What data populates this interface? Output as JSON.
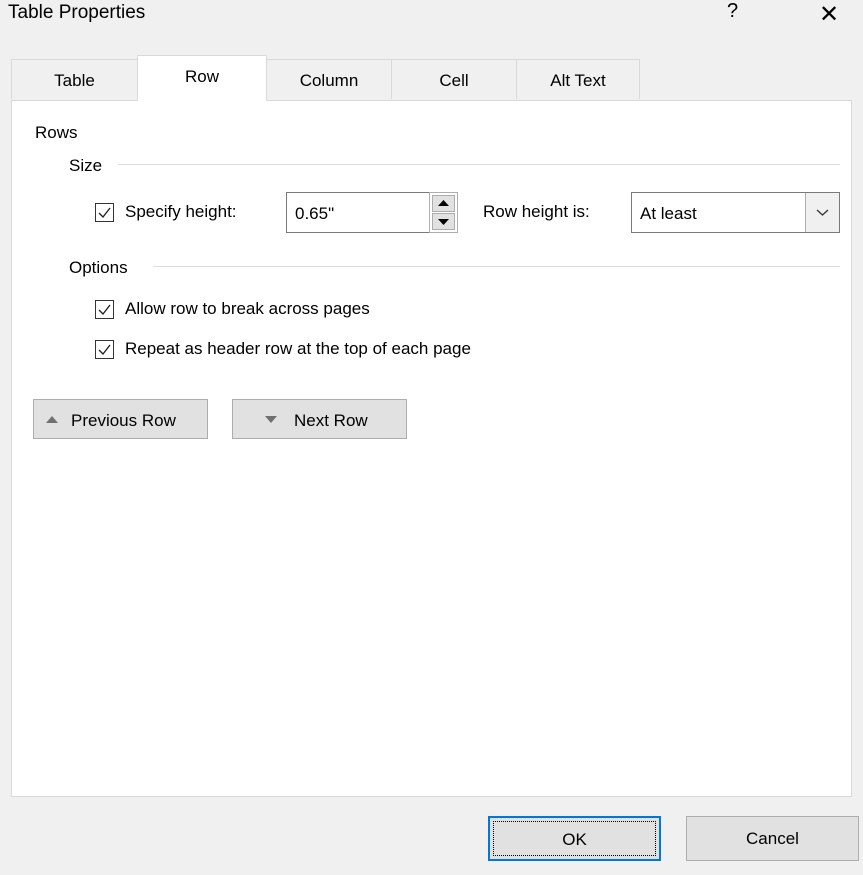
{
  "window": {
    "title": "Table Properties",
    "help_label": "?",
    "close_label": "✕"
  },
  "tabs": [
    {
      "label": "Table"
    },
    {
      "label": "Row"
    },
    {
      "label": "Column"
    },
    {
      "label": "Cell"
    },
    {
      "label": "Alt Text"
    }
  ],
  "row_tab": {
    "rows_heading": "Rows",
    "size_heading": "Size",
    "specify_height": {
      "label": "Specify height:",
      "checked": true,
      "value": "0.65\""
    },
    "row_height_is": {
      "label": "Row height is:",
      "value": "At least"
    },
    "options_heading": "Options",
    "allow_break": {
      "label": "Allow row to break across pages",
      "checked": true
    },
    "repeat_header": {
      "label": "Repeat as header row at the top of each page",
      "checked": true
    },
    "previous_row": "Previous Row",
    "next_row": "Next Row"
  },
  "footer": {
    "ok": "OK",
    "cancel": "Cancel"
  },
  "colors": {
    "accent": "#0078d7",
    "panel": "#ffffff",
    "background": "#f0f0f0"
  }
}
